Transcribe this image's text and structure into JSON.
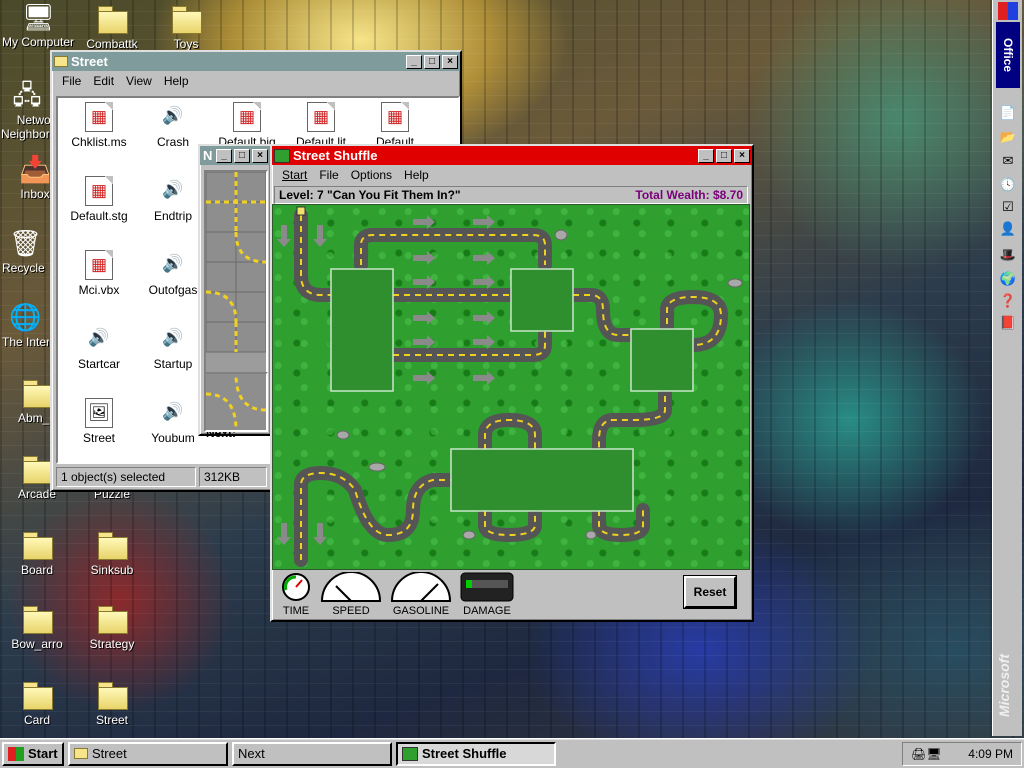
{
  "desktop": {
    "icons": [
      {
        "label": "My Computer",
        "icon": "my-computer-icon",
        "glyph": "🖥"
      },
      {
        "label": "Combattk",
        "icon": "folder-icon"
      },
      {
        "label": "Toys",
        "icon": "folder-icon"
      },
      {
        "label": "Network Neighborhood",
        "icon": "network-icon",
        "glyph": "🖧"
      },
      {
        "label": "Inbox",
        "icon": "inbox-icon",
        "glyph": "📥"
      },
      {
        "label": "Recycle Bin",
        "icon": "recycle-bin-icon",
        "glyph": "🗑"
      },
      {
        "label": "The Internet",
        "icon": "internet-icon",
        "glyph": "🌐"
      },
      {
        "label": "Abm_d",
        "icon": "folder-icon"
      },
      {
        "label": "Arcade",
        "icon": "folder-icon"
      },
      {
        "label": "Puzzle",
        "icon": "folder-icon"
      },
      {
        "label": "Board",
        "icon": "folder-icon"
      },
      {
        "label": "Sinksub",
        "icon": "folder-icon"
      },
      {
        "label": "Bow_arro",
        "icon": "folder-icon"
      },
      {
        "label": "Strategy",
        "icon": "folder-icon"
      },
      {
        "label": "Card",
        "icon": "folder-icon"
      },
      {
        "label": "Street",
        "icon": "folder-icon"
      }
    ]
  },
  "explorer": {
    "title": "Street",
    "menu": [
      "File",
      "Edit",
      "View",
      "Help"
    ],
    "files": [
      {
        "name": "Chklist.ms",
        "icon": "windows-logo-file-icon",
        "glyph": "▦"
      },
      {
        "name": "Crash",
        "icon": "sound-file-icon",
        "glyph": "🔊"
      },
      {
        "name": "Default.big",
        "icon": "windows-logo-file-icon",
        "glyph": "▦"
      },
      {
        "name": "Default.lit",
        "icon": "windows-logo-file-icon",
        "glyph": "▦"
      },
      {
        "name": "Default",
        "icon": "windows-logo-file-icon",
        "glyph": "▦"
      },
      {
        "name": "Default.stg",
        "icon": "windows-logo-file-icon",
        "glyph": "▦"
      },
      {
        "name": "Endtrip",
        "icon": "sound-file-icon",
        "glyph": "🔊"
      },
      {
        "name": "Mci.vbx",
        "icon": "windows-logo-file-icon",
        "glyph": "▦"
      },
      {
        "name": "Outofgas",
        "icon": "sound-file-icon",
        "glyph": "🔊"
      },
      {
        "name": "Startcar",
        "icon": "sound-file-icon",
        "glyph": "🔊"
      },
      {
        "name": "Startup",
        "icon": "sound-file-icon",
        "glyph": "🔊"
      },
      {
        "name": "Street",
        "icon": "street-app-icon",
        "glyph": "🖼"
      },
      {
        "name": "Youbum",
        "icon": "sound-file-icon",
        "glyph": "🔊"
      }
    ],
    "status_selected": "1 object(s) selected",
    "status_size": "312KB"
  },
  "next_panel": {
    "title": "N",
    "next_label": "Next:"
  },
  "game": {
    "title": "Street Shuffle",
    "menu": [
      "Start",
      "File",
      "Options",
      "Help"
    ],
    "level_label": "Level: 7  \"Can You Fit Them In?\"",
    "wealth_label": "Total Wealth: $8.70",
    "gauges": [
      "TIME",
      "SPEED",
      "GASOLINE",
      "DAMAGE"
    ],
    "reset_label": "Reset"
  },
  "officebar": {
    "title": "Office",
    "buttons": [
      "office-logo-icon",
      "new-document-icon",
      "open-folder-icon",
      "mail-icon",
      "schedule-icon",
      "task-icon",
      "contact-icon",
      "hat-icon",
      "globe-icon",
      "help-icon",
      "book-icon"
    ]
  },
  "watermark": "Microsoft",
  "taskbar": {
    "start_label": "Start",
    "tasks": [
      {
        "label": "Street",
        "icon": "folder-icon"
      },
      {
        "label": "Next",
        "icon": ""
      },
      {
        "label": "Street Shuffle",
        "icon": "street-shuffle-icon"
      }
    ],
    "clock": "4:09 PM"
  }
}
